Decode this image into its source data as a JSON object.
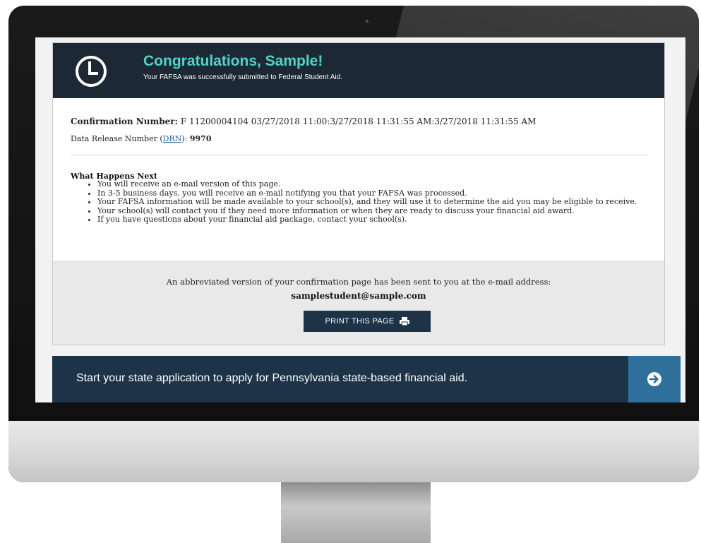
{
  "hero": {
    "title": "Congratulations, Sample!",
    "subtitle": "Your FAFSA was successfully submitted to Federal Student Aid."
  },
  "confirmation": {
    "label": "Confirmation Number:",
    "value": "F 11200004104 03/27/2018 11:00:3/27/2018 11:31:55 AM:3/27/2018 11:31:55 AM"
  },
  "drn": {
    "label_prefix": "Data Release Number (",
    "link": "DRN",
    "label_suffix": "):",
    "value": "9970"
  },
  "next_steps": {
    "title": "What Happens Next",
    "items": [
      "You will receive an e-mail version of this page.",
      "In 3-5 business days, you will receive an e-mail notifying you that your FAFSA was processed.",
      "Your FAFSA information will be made available to your school(s), and they will use it to determine the aid you may be eligible to receive.",
      "Your school(s) will contact you if they need more information or when they are ready to discuss your financial aid award.",
      "If you have questions about your financial aid package, contact your school(s)."
    ]
  },
  "email": {
    "notice": "An abbreviated version of your confirmation page has been sent to you at the e-mail address:",
    "address": "samplestudent@sample.com"
  },
  "print_button": {
    "label": "PRINT THIS PAGE"
  },
  "state_banner": {
    "text": "Start your state application to apply for Pennsylvania state-based financial aid."
  },
  "colors": {
    "header_bg": "#1c2834",
    "accent_teal": "#4fd6c8",
    "button_bg": "#1e3345",
    "banner_bg": "#1d3347",
    "banner_arrow_bg": "#2e6f9c"
  },
  "icons": {
    "hero": "clock-icon",
    "print": "printer-icon",
    "banner": "arrow-right-circle-icon"
  }
}
